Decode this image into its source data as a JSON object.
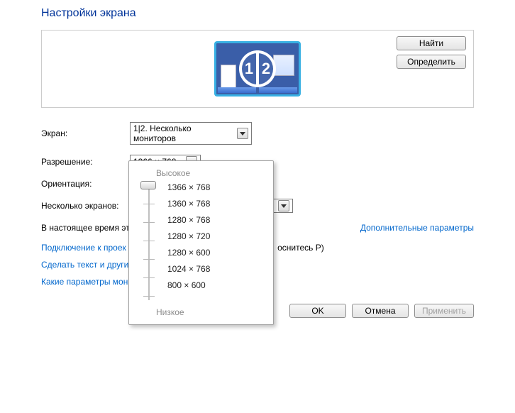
{
  "title": "Настройки экрана",
  "buttons": {
    "find": "Найти",
    "detect": "Определить",
    "ok": "OK",
    "cancel": "Отмена",
    "apply": "Применить"
  },
  "monitor_numbers": {
    "left": "1",
    "right": "2"
  },
  "labels": {
    "screen": "Экран:",
    "resolution": "Разрешение:",
    "orientation": "Ориентация:",
    "multiple": "Несколько экранов:"
  },
  "dropdowns": {
    "screen_value": "1|2. Несколько мониторов",
    "resolution_value": "1366 × 768"
  },
  "status_text": "В настоящее время это",
  "advanced_link": "Дополнительные параметры",
  "link1_a": "Подключение к проек",
  "link1_b": "оснитесь P)",
  "link2": "Сделать текст и другие",
  "link3": "Какие параметры мон",
  "slider": {
    "high": "Высокое",
    "low": "Низкое",
    "options": [
      "1366 × 768",
      "1360 × 768",
      "1280 × 768",
      "1280 × 720",
      "1280 × 600",
      "1024 × 768",
      "800 × 600"
    ]
  }
}
